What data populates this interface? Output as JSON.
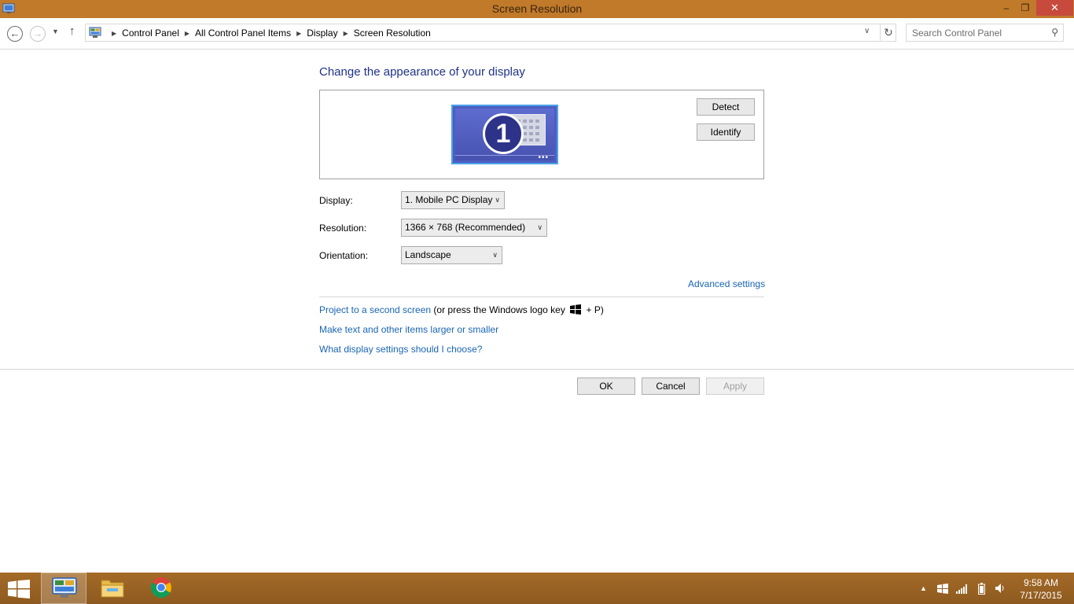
{
  "window": {
    "title": "Screen Resolution",
    "minimize_glyph": "‒",
    "maximize_glyph": "❐",
    "close_glyph": "✕"
  },
  "addressbar": {
    "back_glyph": "←",
    "forward_glyph": "→",
    "recent_glyph": "▼",
    "up_glyph": "↑",
    "breadcrumbs": [
      "Control Panel",
      "All Control Panel Items",
      "Display",
      "Screen Resolution"
    ],
    "separator": "▶",
    "dropdown_glyph": "∨",
    "refresh_glyph": "↻",
    "search_placeholder": "Search Control Panel",
    "search_glyph": "⚲"
  },
  "main": {
    "heading": "Change the appearance of your display",
    "monitor_number": "1",
    "monitor_dots": "•••",
    "detect_label": "Detect",
    "identify_label": "Identify",
    "display_label": "Display:",
    "display_value": "1. Mobile PC Display",
    "resolution_label": "Resolution:",
    "resolution_value": "1366 × 768 (Recommended)",
    "orientation_label": "Orientation:",
    "orientation_value": "Landscape",
    "select_chevron": "∨",
    "advanced_settings": "Advanced settings",
    "project_link": "Project to a second screen",
    "project_hint_pre": " (or press the Windows logo key ",
    "project_hint_post": " + P)",
    "text_size_link": "Make text and other items larger or smaller",
    "help_link": "What display settings should I choose?",
    "ok_label": "OK",
    "cancel_label": "Cancel",
    "apply_label": "Apply"
  },
  "taskbar": {
    "tray_up": "▲",
    "time": "9:58 AM",
    "date": "7/17/2015"
  },
  "colors": {
    "titlebar": "#c07a2a",
    "close_button": "#c74a3d",
    "heading": "#1e3287",
    "link": "#1865b4",
    "taskbar": "#9b6424"
  }
}
